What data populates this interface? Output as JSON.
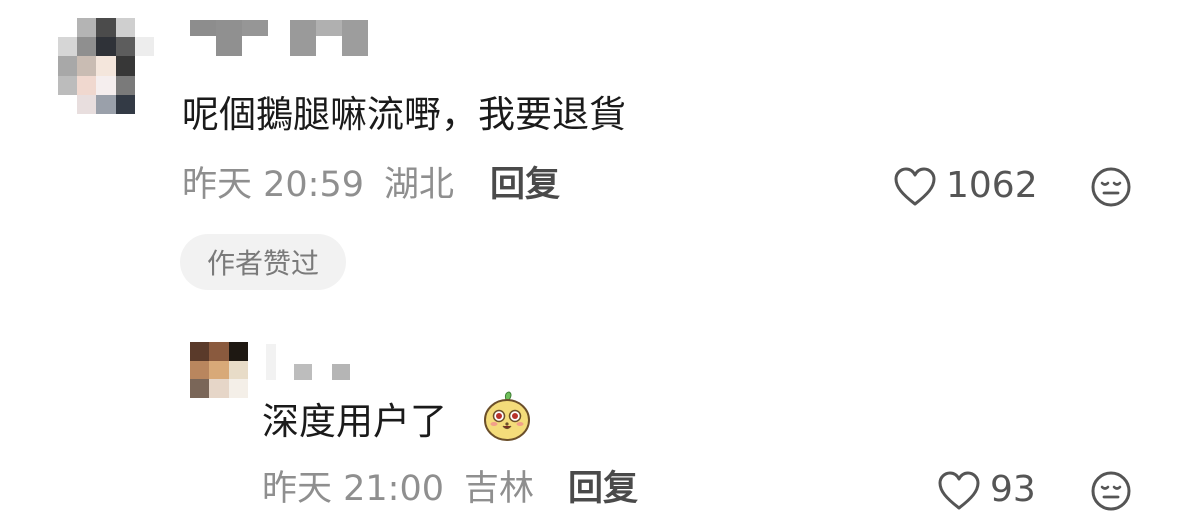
{
  "comment": {
    "avatar_colors": [
      "#ffffff",
      "#b4b4b4",
      "#4b4b4b",
      "#cfcfcf",
      "#ffffff",
      "#d6d6d6",
      "#8f8f8f",
      "#2f3238",
      "#5d5d5d",
      "#ededed",
      "#a8a8a8",
      "#c9bcb3",
      "#f4e6dc",
      "#373737",
      "#ffffff",
      "#bcbcbc",
      "#f0d8cf",
      "#f5eeee",
      "#7a7a7a",
      "#ffffff",
      "#ffffff",
      "#e8dede",
      "#9aa0aa",
      "#333a45",
      "#ffffff"
    ],
    "text": "呢個鵝腿嘛流嘢，我要退貨",
    "time": "昨天 20:59",
    "location": "湖北",
    "reply_label": "回复",
    "like_icon": "heart-outline-icon",
    "like_count": "1062",
    "badge": "作者赞过",
    "more_icon": "neutral-face-icon"
  },
  "reply": {
    "avatar_colors": [
      "#5a3a2a",
      "#8a5a3e",
      "#1e1812",
      "#b9865e",
      "#d8a978",
      "#e8dcc8",
      "#7a6658",
      "#e6d6c8",
      "#f4efe8"
    ],
    "text": "深度用户了",
    "emoji_icon": "smiling-cartoon-sticker-icon",
    "time": "昨天 21:00",
    "location": "吉林",
    "reply_label": "回复",
    "like_icon": "heart-outline-icon",
    "like_count": "93",
    "more_icon": "neutral-face-icon"
  }
}
